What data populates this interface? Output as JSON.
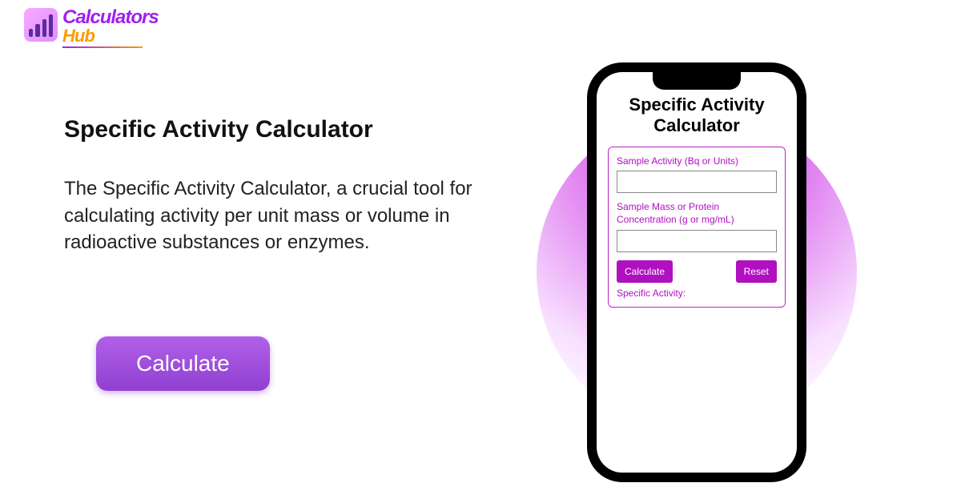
{
  "logo": {
    "line1": "Calculators",
    "line2": "Hub"
  },
  "hero": {
    "title": "Specific Activity Calculator",
    "description": "The Specific Activity Calculator, a crucial tool for calculating activity per unit mass or volume in radioactive substances or enzymes.",
    "cta": "Calculate"
  },
  "phone": {
    "title": "Specific Activity Calculator",
    "field1_label": "Sample Activity (Bq or Units)",
    "field1_value": "",
    "field2_label": "Sample Mass or Protein Concentration (g or mg/mL)",
    "field2_value": "",
    "calculate_btn": "Calculate",
    "reset_btn": "Reset",
    "result_label": "Specific Activity:"
  }
}
